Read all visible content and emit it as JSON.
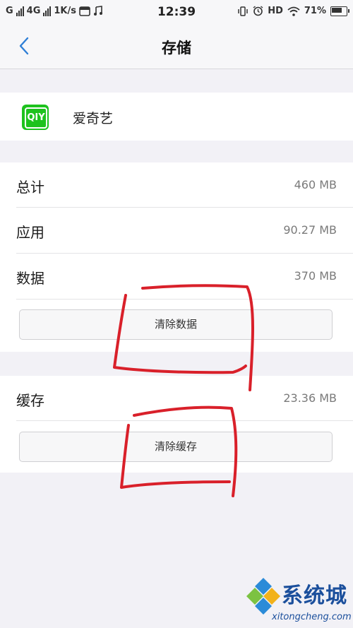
{
  "status_bar": {
    "network_carrier": "G",
    "network_type": "4G",
    "speed": "1K/s",
    "time": "12:39",
    "hd_label": "HD",
    "battery_percent": "71%"
  },
  "header": {
    "title": "存储"
  },
  "app": {
    "name": "爱奇艺",
    "icon_text": "QIY",
    "icon_color": "#1ec21e"
  },
  "storage": {
    "rows": [
      {
        "label": "总计",
        "value": "460 MB"
      },
      {
        "label": "应用",
        "value": "90.27 MB"
      },
      {
        "label": "数据",
        "value": "370 MB"
      }
    ],
    "clear_data_button": "清除数据"
  },
  "cache": {
    "label": "缓存",
    "value": "23.36 MB",
    "clear_cache_button": "清除缓存"
  },
  "colors": {
    "accent": "#2f7fd6",
    "annotation": "#d9202a"
  },
  "watermark": {
    "brand": "系统城",
    "url": "xitongcheng.com"
  }
}
